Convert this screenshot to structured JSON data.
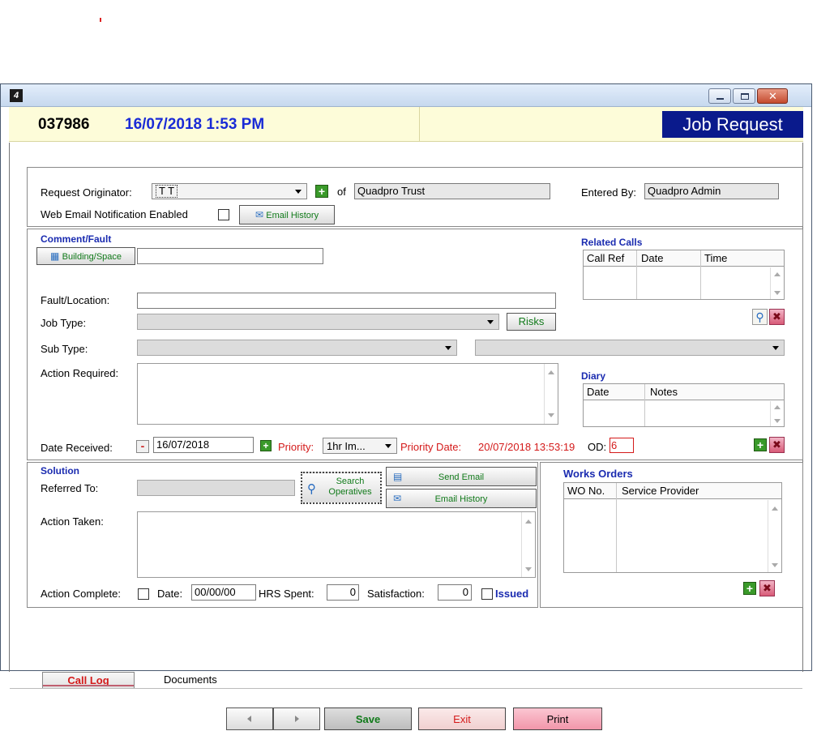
{
  "window": {
    "job_no": "037986",
    "datetime": "16/07/2018  1:53 PM",
    "title": "Job Request"
  },
  "originator": {
    "label": "Request Originator:",
    "value": "T T",
    "of_label": "of",
    "of_value": "Quadpro Trust",
    "entered_by_label": "Entered By:",
    "entered_by_value": "Quadpro Admin",
    "web_email_label": "Web Email Notification Enabled",
    "email_history_label": "Email History"
  },
  "comment": {
    "section_label": "Comment/Fault",
    "building_button": "Building/Space",
    "building_value": "",
    "fault_label": "Fault/Location:",
    "fault_value": "",
    "job_type_label": "Job Type:",
    "job_type_value": "",
    "risks_label": "Risks",
    "sub_type_label": "Sub Type:",
    "sub_type_value": "",
    "sub_type2_value": "",
    "action_required_label": "Action Required:",
    "action_required_value": "",
    "date_received_label": "Date Received:",
    "date_received_value": "16/07/2018",
    "priority_label": "Priority:",
    "priority_value": "1hr Im...",
    "priority_date_label": "Priority Date:",
    "priority_date_value": "20/07/2018 13:53:19",
    "od_label": "OD:",
    "od_value": "6"
  },
  "related_calls": {
    "section_label": "Related Calls",
    "columns": [
      "Call Ref",
      "Date",
      "Time"
    ]
  },
  "diary": {
    "section_label": "Diary",
    "columns": [
      "Date",
      "Notes"
    ]
  },
  "solution": {
    "section_label": "Solution",
    "referred_to_label": "Referred To:",
    "referred_to_value": "",
    "search_button": "Search Operatives",
    "send_email_label": "Send Email",
    "email_history_label": "Email History",
    "action_taken_label": "Action Taken:",
    "action_taken_value": "",
    "action_complete_label": "Action Complete:",
    "date_label": "Date:",
    "date_value": "00/00/00",
    "hrs_label": "HRS Spent:",
    "hrs_value": "0",
    "satisfaction_label": "Satisfaction:",
    "satisfaction_value": "0",
    "issued_label": "Issued"
  },
  "works_orders": {
    "section_label": "Works Orders",
    "columns": [
      "WO No.",
      "Service Provider"
    ]
  },
  "tabs": [
    "Call Log",
    "Documents"
  ],
  "footer": {
    "save_label": "Save",
    "exit_label": "Exit",
    "print_label": "Print"
  },
  "colors": {
    "header_band": "#fdfcd9",
    "title_bg": "#0a1a8c",
    "date_text": "#1a2bd6",
    "section_text": "#1a2bb0",
    "priority_red": "#d41a1a",
    "save_bg": "#c9c9c9",
    "exit_bg": "#f6dcdc",
    "print_bg": "#f6a8b8"
  }
}
